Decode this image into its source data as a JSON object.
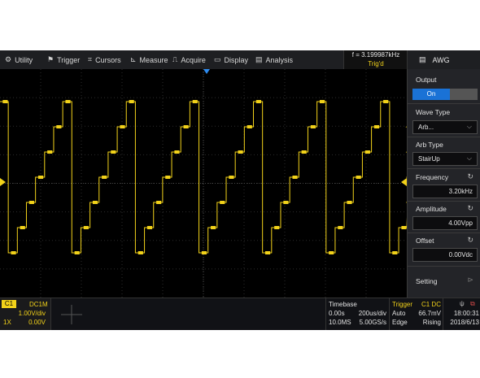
{
  "menu": {
    "items": [
      {
        "label": "Utility",
        "icon": "gear-icon",
        "glyph": "⚙"
      },
      {
        "label": "Trigger",
        "icon": "flag-icon",
        "glyph": "⚑"
      },
      {
        "label": "Cursors",
        "icon": "cursor-cross-icon",
        "glyph": "⌗"
      },
      {
        "label": "Measure",
        "icon": "measure-icon",
        "glyph": "⊾"
      },
      {
        "label": "Acquire",
        "icon": "acquire-icon",
        "glyph": "⎍"
      },
      {
        "label": "Display",
        "icon": "display-icon",
        "glyph": "▭"
      },
      {
        "label": "Analysis",
        "icon": "analysis-icon",
        "glyph": "▤"
      }
    ],
    "frequency": "f = 3.199987kHz",
    "trigger_state": "Trig'd",
    "panel_title": "AWG",
    "panel_icon": "awg-icon"
  },
  "panel": {
    "output_label": "Output",
    "output_value": "On",
    "wave_type_label": "Wave Type",
    "wave_type_value": "Arb...",
    "arb_type_label": "Arb Type",
    "arb_type_value": "StairUp",
    "frequency_label": "Frequency",
    "frequency_value": "3.20kHz",
    "amplitude_label": "Amplitude",
    "amplitude_value": "4.00Vpp",
    "offset_label": "Offset",
    "offset_value": "0.00Vdc",
    "setting_label": "Setting"
  },
  "status": {
    "channel": "C1",
    "coupling": "DC1M",
    "scale": "1.00V/div",
    "probe": "1X",
    "offset": "0.00V",
    "timebase_label": "Timebase",
    "timebase_delay": "0.00s",
    "timebase_scale": "200us/div",
    "memory_depth": "10.0MS",
    "sample_rate": "5.00GS/s",
    "trigger_label": "Trigger",
    "trigger_source": "C1 DC",
    "trigger_mode": "Auto",
    "trigger_level": "66.7mV",
    "trigger_type": "Edge",
    "trigger_slope": "Rising",
    "time": "18:00:31",
    "date": "2018/6/13"
  },
  "colors": {
    "trace": "#f2d21a",
    "accent": "#1a72d6",
    "trigger_marker": "#2e8cf0"
  },
  "waveform": {
    "periods_visible": 6.4,
    "steps_per_period": 7,
    "phase_offset": 0.87
  }
}
